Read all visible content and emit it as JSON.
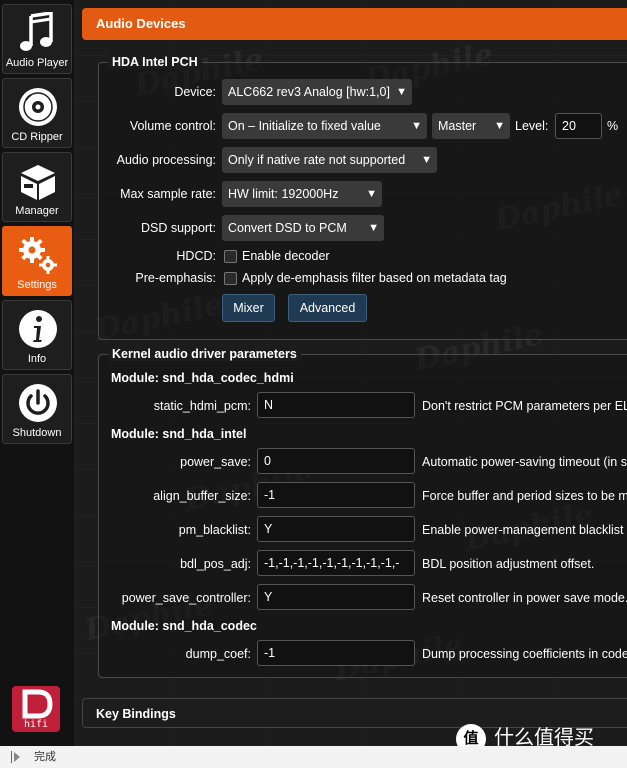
{
  "sidebar": {
    "items": [
      {
        "label": "Audio Player",
        "icon": "music-note-icon",
        "active": false
      },
      {
        "label": "CD Ripper",
        "icon": "disc-icon",
        "active": false
      },
      {
        "label": "Manager",
        "icon": "box-icon",
        "active": false
      },
      {
        "label": "Settings",
        "icon": "gears-icon",
        "active": true
      },
      {
        "label": "Info",
        "icon": "info-icon",
        "active": false
      },
      {
        "label": "Shutdown",
        "icon": "power-icon",
        "active": false
      }
    ],
    "logo_text": "hifi"
  },
  "watermark_text": "Daphile",
  "colors": {
    "accent": "#e35b12",
    "button": "#1f3a52",
    "logo": "#c01f3a"
  },
  "panel": {
    "title": "Audio Devices"
  },
  "device_section": {
    "legend": "HDA Intel PCH",
    "device": {
      "label": "Device:",
      "value": "ALC662 rev3 Analog [hw:1,0]"
    },
    "volume": {
      "label": "Volume control:",
      "mode": "On – Initialize to fixed value",
      "mixer": "Master",
      "level_label": "Level:",
      "level": "20",
      "unit": "%"
    },
    "processing": {
      "label": "Audio processing:",
      "value": "Only if native rate not supported"
    },
    "sample_rate": {
      "label": "Max sample rate:",
      "value": "HW limit: 192000Hz"
    },
    "dsd": {
      "label": "DSD support:",
      "value": "Convert DSD to PCM"
    },
    "hdcd": {
      "label": "HDCD:",
      "text": "Enable decoder",
      "checked": false
    },
    "preemphasis": {
      "label": "Pre-emphasis:",
      "text": "Apply de-emphasis filter based on metadata tag",
      "checked": false
    },
    "buttons": {
      "mixer": "Mixer",
      "advanced": "Advanced"
    }
  },
  "kernel_section": {
    "legend": "Kernel audio driver parameters",
    "modules": [
      {
        "name": "Module: snd_hda_codec_hdmi",
        "params": [
          {
            "name": "static_hdmi_pcm:",
            "value": "N",
            "desc": "Don't restrict PCM parameters per ELD info"
          }
        ]
      },
      {
        "name": "Module: snd_hda_intel",
        "params": [
          {
            "name": "power_save:",
            "value": "0",
            "desc": "Automatic power-saving timeout (in seconds)"
          },
          {
            "name": "align_buffer_size:",
            "value": "-1",
            "desc": "Force buffer and period sizes to be multiple"
          },
          {
            "name": "pm_blacklist:",
            "value": "Y",
            "desc": "Enable power-management blacklist"
          },
          {
            "name": "bdl_pos_adj:",
            "value": "-1,-1,-1,-1,-1,-1,-1,-1,-1,-",
            "desc": "BDL position adjustment offset."
          },
          {
            "name": "power_save_controller:",
            "value": "Y",
            "desc": "Reset controller in power save mode."
          }
        ]
      },
      {
        "name": "Module: snd_hda_codec",
        "params": [
          {
            "name": "dump_coef:",
            "value": "-1",
            "desc": "Dump processing coefficients in codec proc"
          }
        ]
      }
    ]
  },
  "key_bindings": {
    "title": "Key Bindings"
  },
  "corner_badge": {
    "logo": "值",
    "text": "什么值得买"
  },
  "statusbar": {
    "text": "完成"
  }
}
